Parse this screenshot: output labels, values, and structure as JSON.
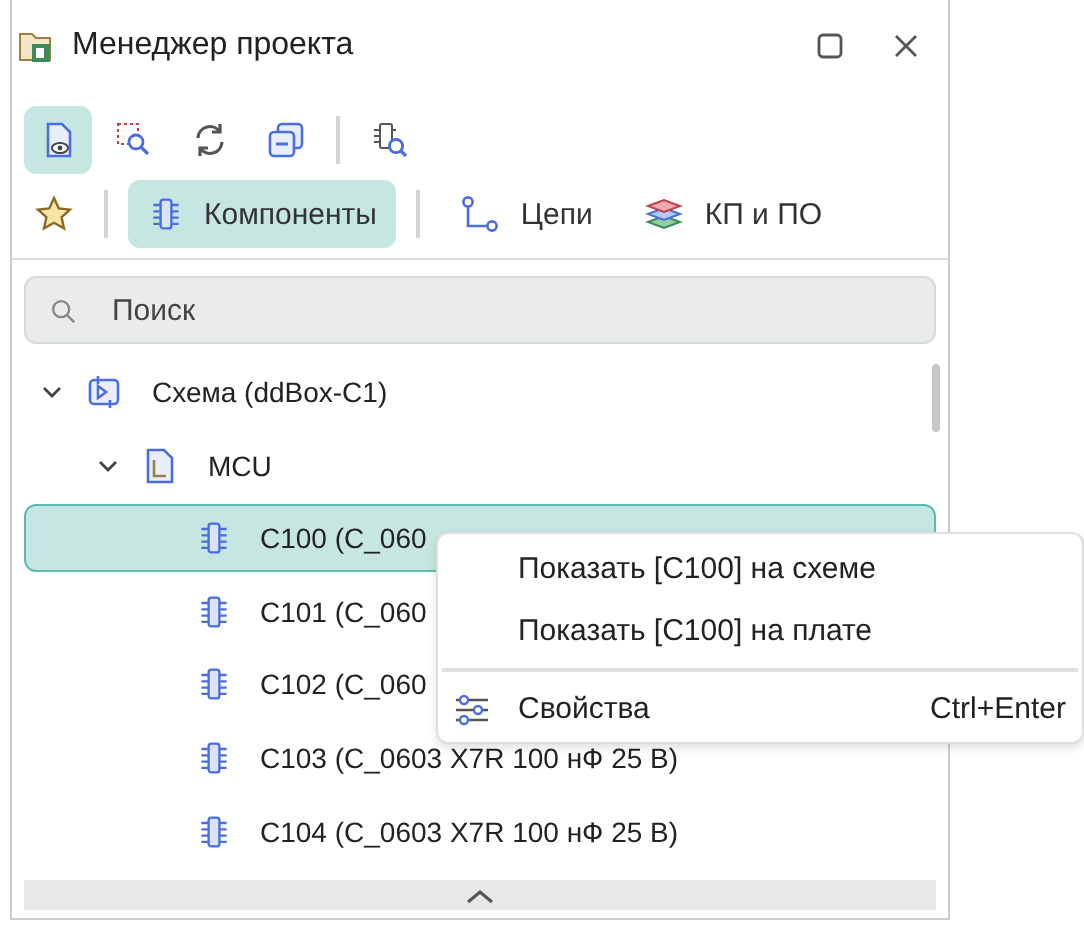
{
  "window": {
    "title": "Менеджер проекта"
  },
  "toolbar": [
    {
      "kind": "view",
      "selected": true
    },
    {
      "kind": "select",
      "selected": false
    },
    {
      "kind": "refresh",
      "selected": false
    },
    {
      "kind": "collapse",
      "selected": false
    },
    {
      "kind": "find",
      "selected": false
    }
  ],
  "tabs": [
    {
      "kind": "favorites",
      "selected": false
    },
    {
      "kind": "components",
      "label": "Компоненты",
      "selected": true
    },
    {
      "kind": "nets",
      "label": "Цепи",
      "selected": false
    },
    {
      "kind": "pads",
      "label": "КП и ПО",
      "selected": false
    }
  ],
  "search": {
    "placeholder": "Поиск"
  },
  "tree": [
    {
      "kind": "schematic",
      "label": "Схема (ddBox-C1)",
      "expanded": true,
      "selected": false,
      "children": [
        {
          "kind": "sheet",
          "label": "MCU",
          "expanded": true,
          "selected": false,
          "children": [
            {
              "kind": "component",
              "label": "C100 (C_060",
              "selected": true
            },
            {
              "kind": "component",
              "label": "C101 (C_060",
              "selected": false
            },
            {
              "kind": "component",
              "label": "C102 (C_060",
              "selected": false
            },
            {
              "kind": "component",
              "label": "C103 (C_0603 X7R 100 нФ 25 В)",
              "selected": false
            },
            {
              "kind": "component",
              "label": "C104 (C_0603 X7R 100 нФ 25 В)",
              "selected": false
            }
          ]
        }
      ]
    }
  ],
  "context_menu": {
    "items": [
      {
        "kind": "plain",
        "label": "Показать [C100] на схеме"
      },
      {
        "kind": "plain",
        "label": "Показать [C100] на плате"
      },
      {
        "kind": "properties",
        "label": "Свойства",
        "shortcut": "Ctrl+Enter"
      }
    ]
  }
}
